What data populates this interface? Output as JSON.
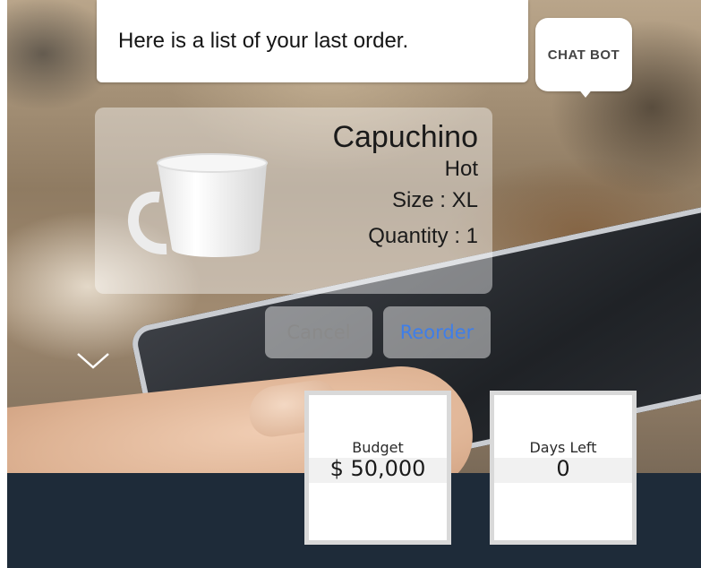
{
  "chat": {
    "message": "Here is a list of your last order.",
    "bot_label": "CHAT BOT"
  },
  "order": {
    "product": "Capuchino",
    "temperature": "Hot",
    "size": "Size : XL",
    "quantity": "Quantity : 1",
    "icon": "coffee-cup-icon"
  },
  "actions": {
    "cancel_label": "Cancel",
    "reorder_label": "Reorder"
  },
  "collapse_icon": "chevron-down-icon",
  "stats": {
    "budget_label": "Budget",
    "budget_value": "$ 50,000",
    "days_label": "Days Left",
    "days_value": "0"
  },
  "colors": {
    "accent": "#3f7ee8",
    "footer": "#1e2b39",
    "muted_text": "#8a8a8a"
  }
}
